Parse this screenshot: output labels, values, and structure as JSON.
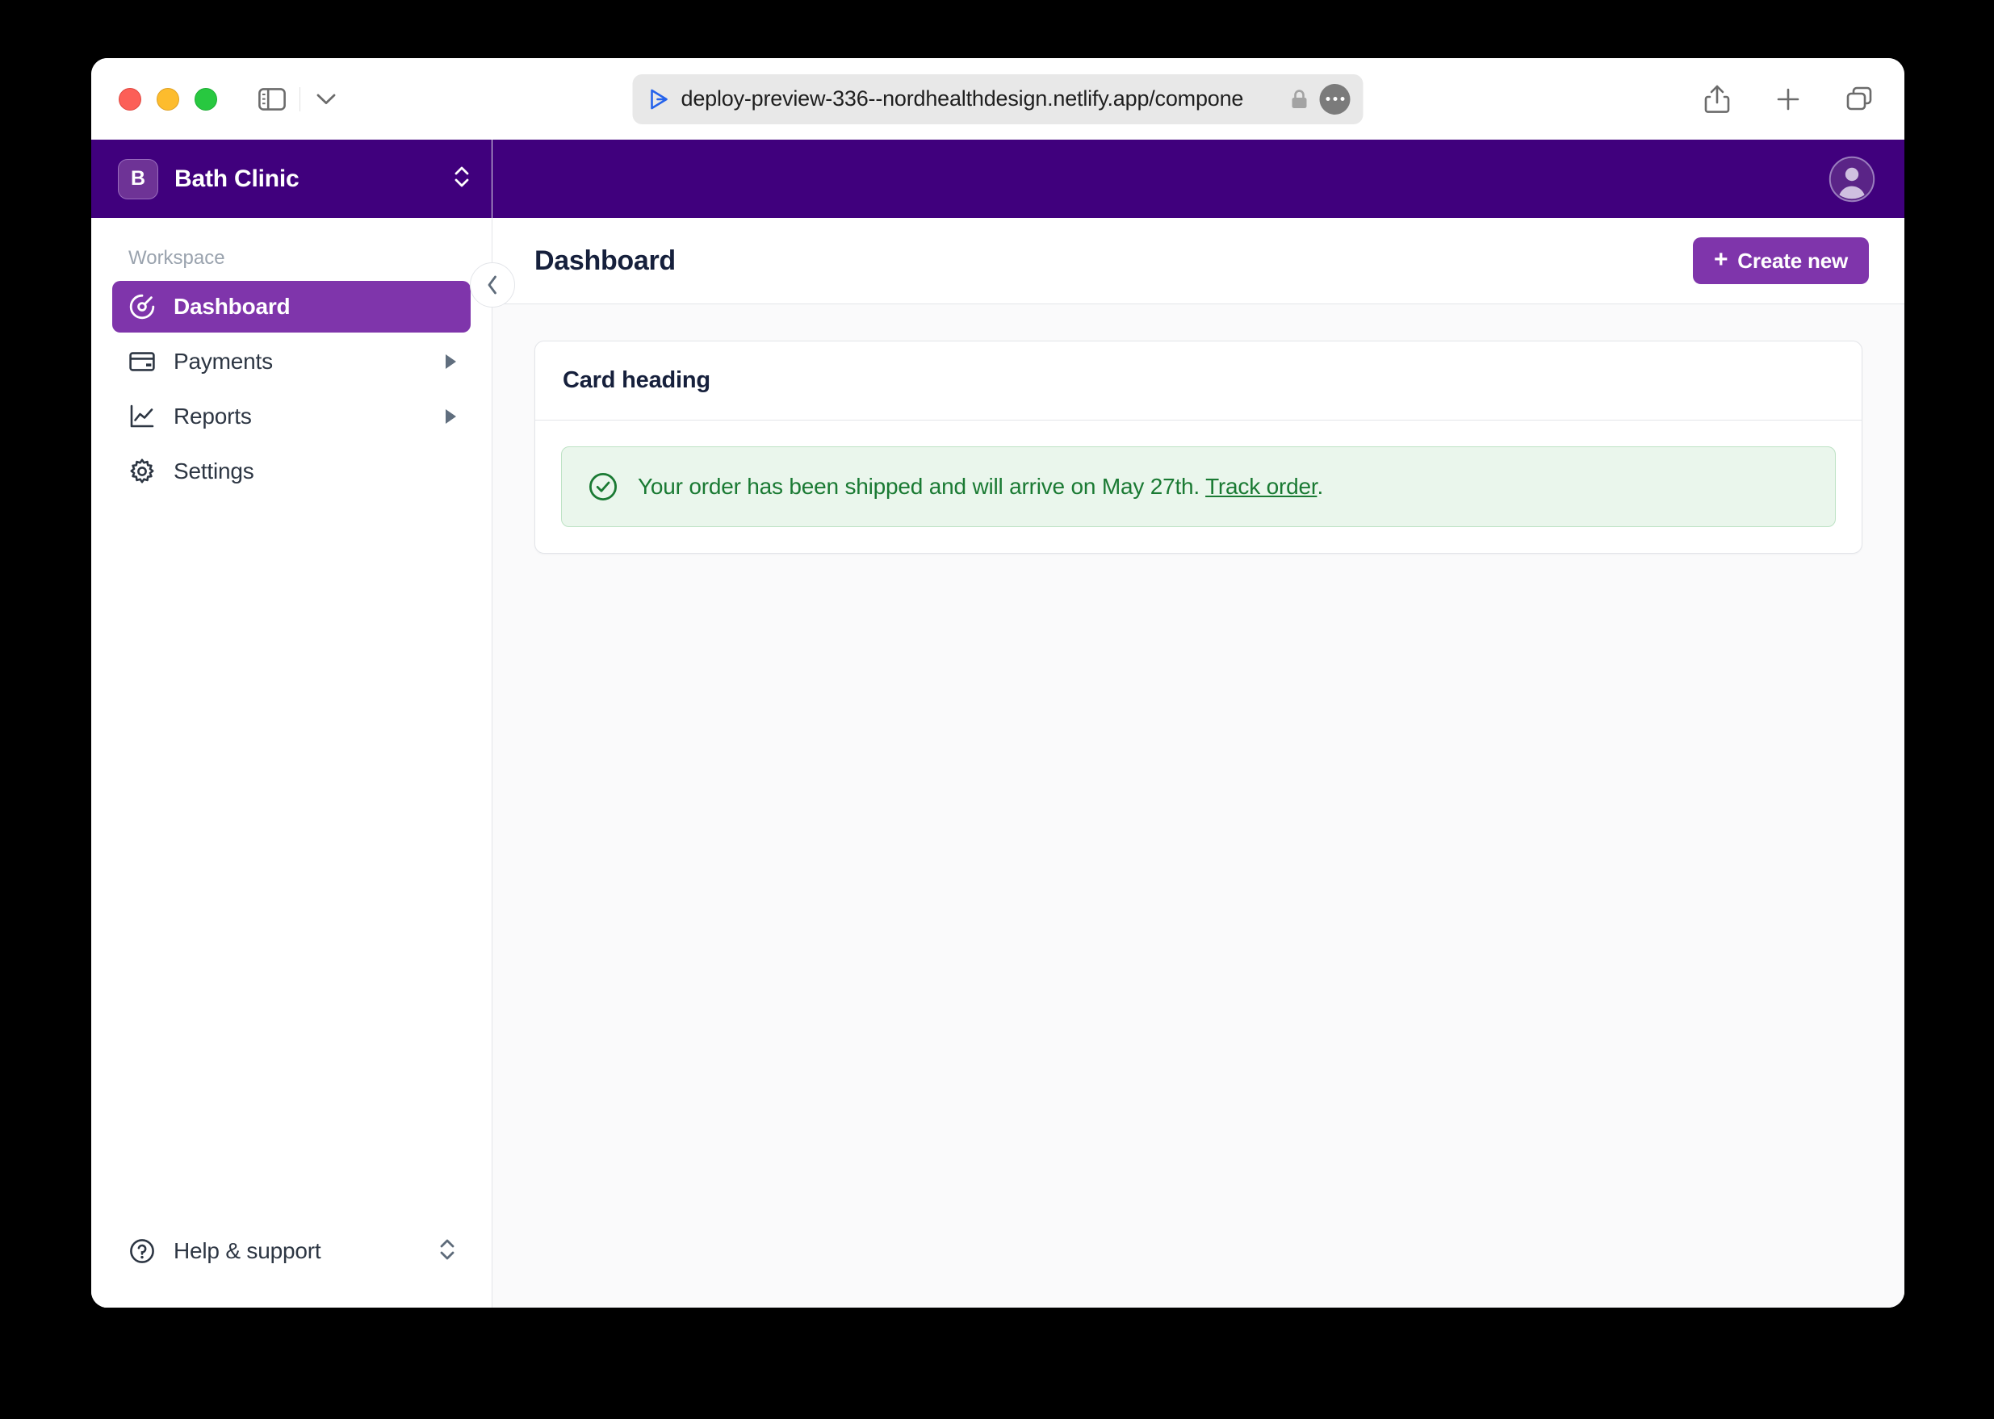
{
  "browser": {
    "traffic_lights": [
      "close",
      "minimize",
      "maximize"
    ],
    "url": "deploy-preview-336--nordhealthdesign.netlify.app/compone",
    "url_placeholder": "Search or enter website name",
    "icons": {
      "sidebar_toggle": "sidebar-toggle-icon",
      "chevron_down": "chevron-down-icon",
      "favicon": "netlify-favicon",
      "lock": "lock-icon",
      "more": "ellipsis-icon",
      "share": "share-icon",
      "new_tab": "plus-icon",
      "tab_overview": "tab-overview-icon"
    }
  },
  "app": {
    "workspace": {
      "avatar_initial": "B",
      "name": "Bath Clinic",
      "switcher_icon": "chevron-up-down-icon"
    },
    "nav": {
      "section_label": "Workspace",
      "items": [
        {
          "label": "Dashboard",
          "icon": "gauge-icon",
          "active": true,
          "expandable": false
        },
        {
          "label": "Payments",
          "icon": "card-icon",
          "active": false,
          "expandable": true
        },
        {
          "label": "Reports",
          "icon": "chart-icon",
          "active": false,
          "expandable": true
        },
        {
          "label": "Settings",
          "icon": "gear-icon",
          "active": false,
          "expandable": false
        }
      ]
    },
    "footer": {
      "label": "Help & support",
      "icon": "question-circle-icon",
      "switcher_icon": "chevron-up-down-icon"
    },
    "topbar": {
      "avatar_icon": "user-avatar-icon"
    },
    "page": {
      "title": "Dashboard",
      "collapse_icon": "chevron-left-icon",
      "create_button": {
        "label": "Create new",
        "plus": "+"
      }
    },
    "card": {
      "heading": "Card heading",
      "alert": {
        "icon": "check-circle-icon",
        "text_before": "Your order has been shipped and will arrive on May 27th.",
        "link_label": "Track order",
        "text_after": "."
      }
    }
  },
  "colors": {
    "brand_deep_purple": "#40007D",
    "brand_purple": "#7F35AB",
    "success_text": "#1A7A33",
    "success_bg": "#EAF6EC",
    "success_border": "#BDE2C4",
    "heading_navy": "#16203C",
    "page_bg": "#FAFAFB",
    "border": "#E3E5E9"
  }
}
